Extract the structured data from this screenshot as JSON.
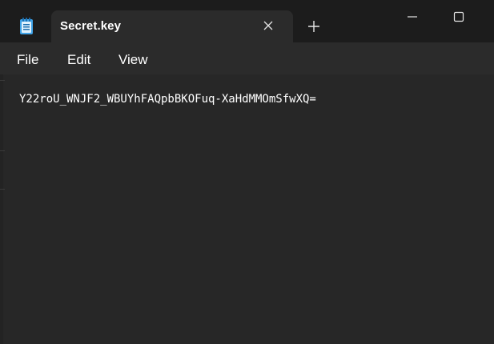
{
  "tab": {
    "title": "Secret.key",
    "icon": "notepad-icon"
  },
  "window_controls": {
    "new_tab_icon": "plus-icon",
    "close_tab_icon": "close-icon",
    "minimize_icon": "minimize-icon",
    "maximize_icon": "maximize-icon"
  },
  "menu": {
    "file": "File",
    "edit": "Edit",
    "view": "View"
  },
  "editor": {
    "content": "Y22roU_WNJF2_WBUYhFAQpbBKOFuq-XaHdMMOmSfwXQ="
  },
  "colors": {
    "titlebar": "#1c1c1c",
    "tab": "#2b2b2b",
    "editor": "#272727",
    "text": "#ffffff",
    "icon_accent": "#3fa3e8"
  }
}
